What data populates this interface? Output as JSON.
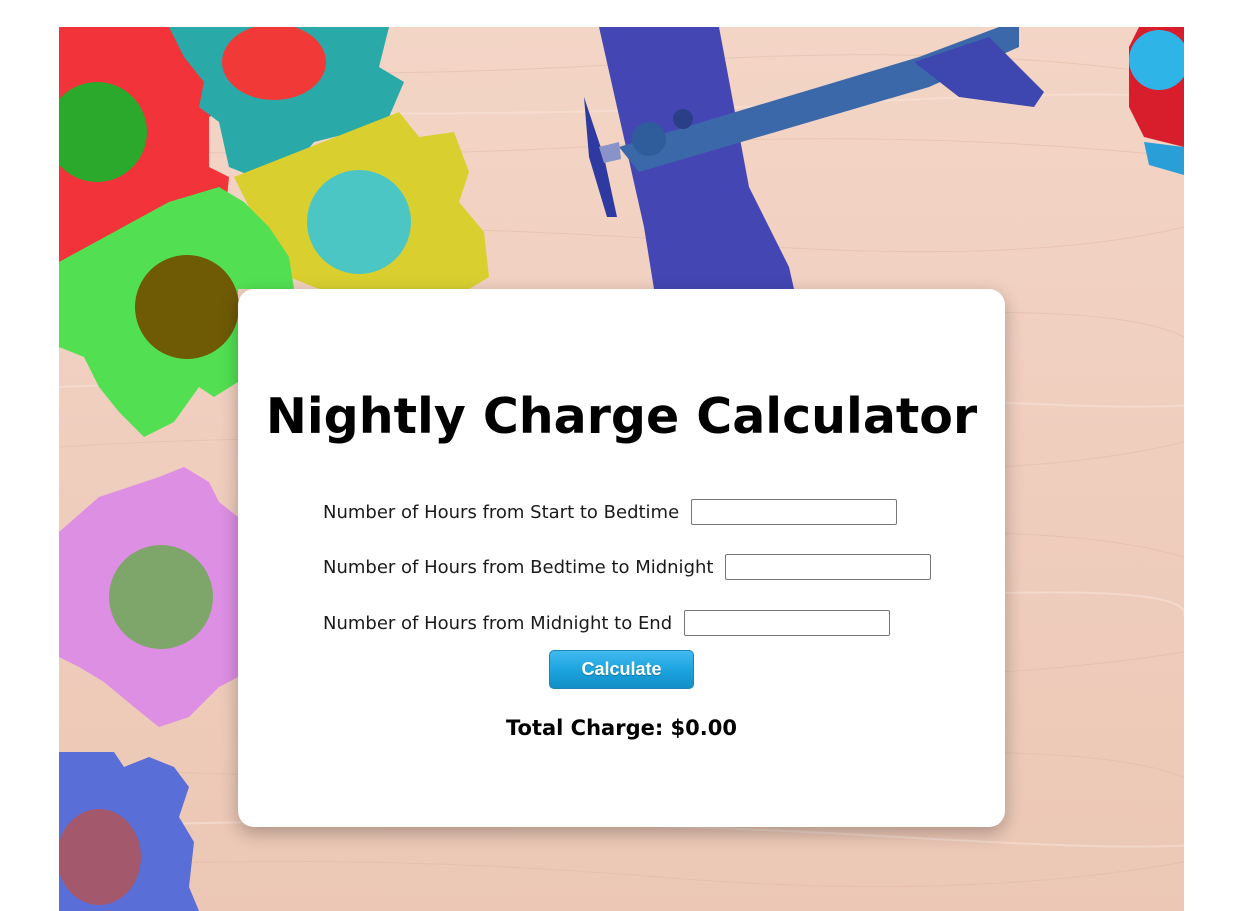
{
  "page": {
    "title": "Nightly Charge Calculator"
  },
  "form": {
    "fields": [
      {
        "label": "Number of Hours from Start to Bedtime",
        "value": ""
      },
      {
        "label": "Number of Hours from Bedtime to Midnight",
        "value": ""
      },
      {
        "label": "Number of Hours from Midnight to End",
        "value": ""
      }
    ],
    "calculate_label": "Calculate"
  },
  "result": {
    "total_label": "Total Charge: $0.00"
  },
  "colors": {
    "button": "#1aa2dc",
    "background": "#efcdbd"
  }
}
